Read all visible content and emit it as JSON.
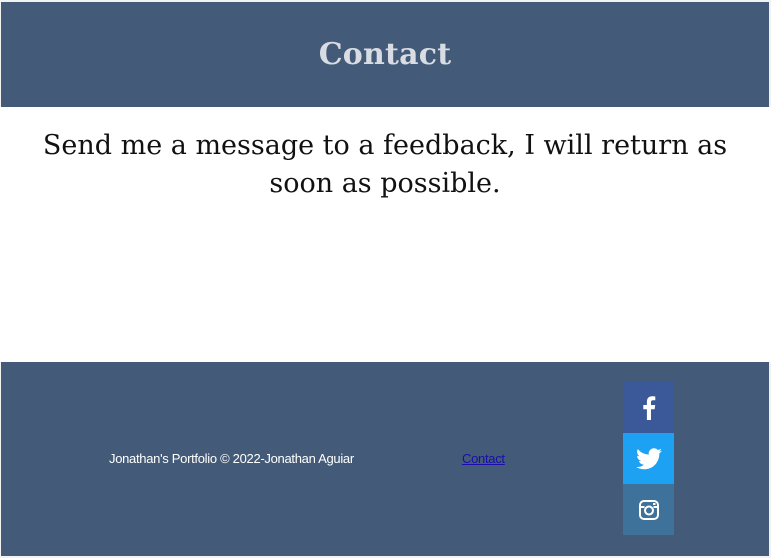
{
  "header": {
    "title": "Contact"
  },
  "main": {
    "message": "Send me a message to a feedback, I will return as soon as possible."
  },
  "footer": {
    "copyright": "Jonathan's Portfolio © 2022-Jonathan Aguiar",
    "contact_link": "Contact",
    "social": [
      {
        "name": "facebook-icon",
        "color": "#3b5998"
      },
      {
        "name": "twitter-icon",
        "color": "#1da1f2"
      },
      {
        "name": "instagram-icon",
        "color": "#3f729b"
      }
    ]
  },
  "colors": {
    "header_bg": "#435b78",
    "footer_bg": "#435b78",
    "header_text": "#d9dde3",
    "body_text": "#111111",
    "link": "#1a0dab"
  }
}
